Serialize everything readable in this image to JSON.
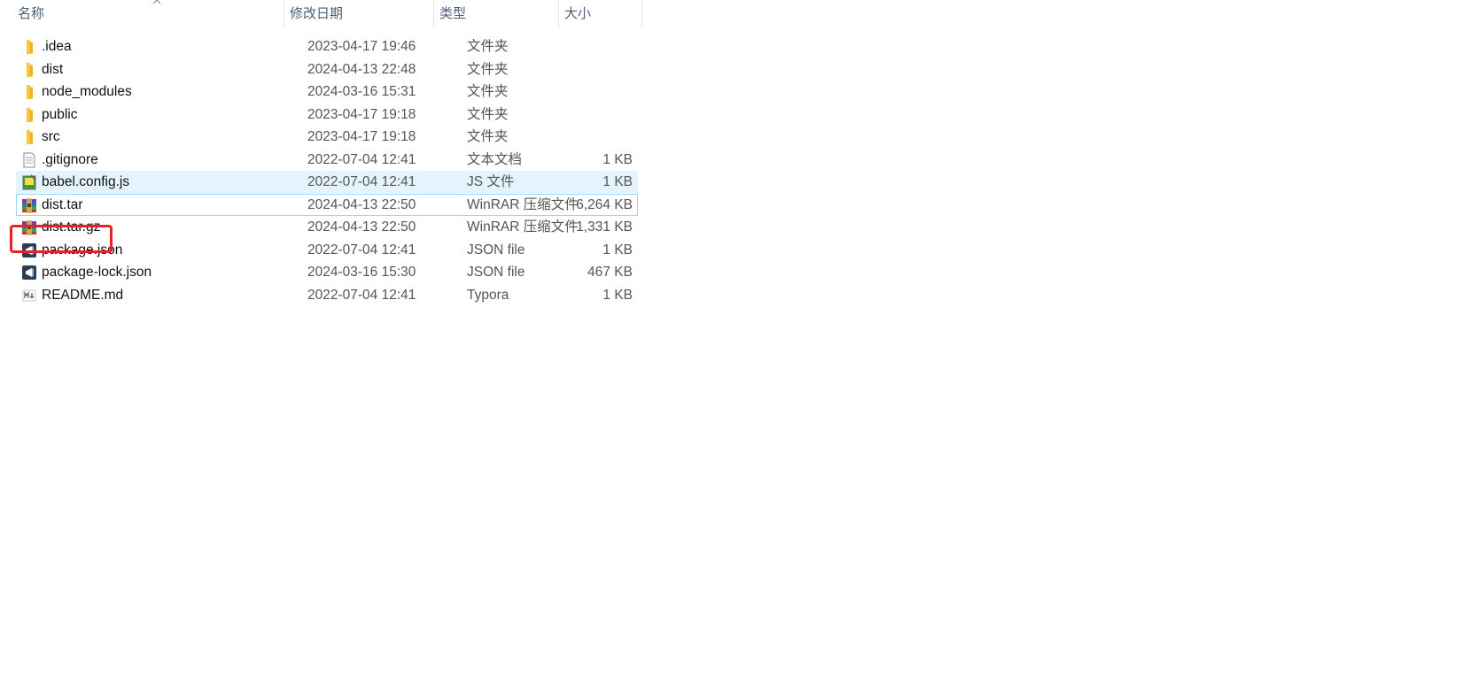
{
  "columns": {
    "name": "名称",
    "date": "修改日期",
    "type": "类型",
    "size": "大小"
  },
  "files": [
    {
      "name": ".idea",
      "date": "2023-04-17 19:46",
      "type": "文件夹",
      "size": "",
      "icon": "folder-icon"
    },
    {
      "name": "dist",
      "date": "2024-04-13 22:48",
      "type": "文件夹",
      "size": "",
      "icon": "folder-icon"
    },
    {
      "name": "node_modules",
      "date": "2024-03-16 15:31",
      "type": "文件夹",
      "size": "",
      "icon": "folder-icon"
    },
    {
      "name": "public",
      "date": "2023-04-17 19:18",
      "type": "文件夹",
      "size": "",
      "icon": "folder-icon"
    },
    {
      "name": "src",
      "date": "2023-04-17 19:18",
      "type": "文件夹",
      "size": "",
      "icon": "folder-icon"
    },
    {
      "name": ".gitignore",
      "date": "2022-07-04 12:41",
      "type": "文本文档",
      "size": "1 KB",
      "icon": "text-file-icon"
    },
    {
      "name": "babel.config.js",
      "date": "2022-07-04 12:41",
      "type": "JS 文件",
      "size": "1 KB",
      "icon": "js-file-icon"
    },
    {
      "name": "dist.tar",
      "date": "2024-04-13 22:50",
      "type": "WinRAR 压缩文件",
      "size": "6,264 KB",
      "icon": "winrar-archive-icon"
    },
    {
      "name": "dist.tar.gz",
      "date": "2024-04-13 22:50",
      "type": "WinRAR 压缩文件",
      "size": "1,331 KB",
      "icon": "winrar-archive-icon"
    },
    {
      "name": "package.json",
      "date": "2022-07-04 12:41",
      "type": "JSON file",
      "size": "1 KB",
      "icon": "vscode-file-icon"
    },
    {
      "name": "package-lock.json",
      "date": "2024-03-16 15:30",
      "type": "JSON file",
      "size": "467 KB",
      "icon": "vscode-file-icon"
    },
    {
      "name": "README.md",
      "date": "2022-07-04 12:41",
      "type": "Typora",
      "size": "1 KB",
      "icon": "markdown-file-icon"
    }
  ],
  "colors": {
    "header_text": "#4c607a",
    "hover_bg": "#e5f3ff",
    "selected_border": "#99d1ff",
    "highlight_box": "#e8202a",
    "folder": "#f8c83c"
  }
}
